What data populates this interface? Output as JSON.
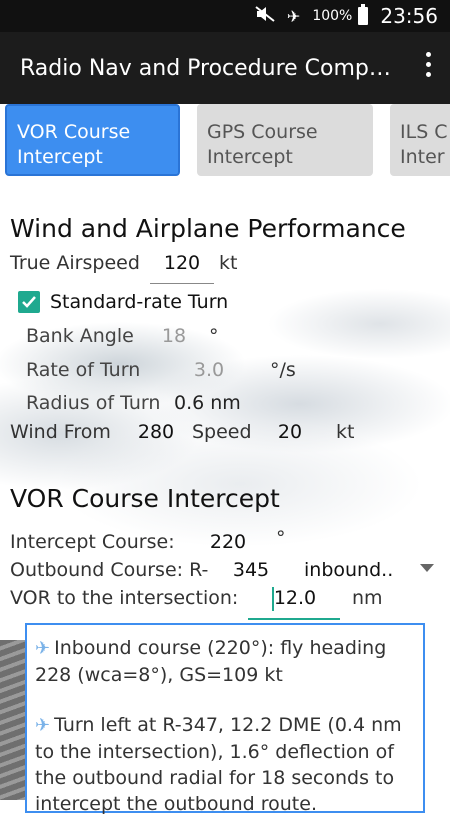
{
  "status_bar": {
    "battery_pct": "100%",
    "time": "23:56",
    "icons": [
      "mute-icon",
      "airplane-mode-icon",
      "battery-icon"
    ]
  },
  "app_bar": {
    "title": "Radio Nav and Procedure Comp…"
  },
  "tabs": [
    {
      "label_line1": "VOR Course",
      "label_line2": "Intercept",
      "active": true
    },
    {
      "label_line1": "GPS Course",
      "label_line2": "Intercept",
      "active": false
    },
    {
      "label_line1": "ILS C",
      "label_line2": "Inter",
      "active": false
    }
  ],
  "wind_section": {
    "heading": "Wind and Airplane Performance",
    "true_airspeed_label": "True Airspeed",
    "true_airspeed_value": "120",
    "true_airspeed_unit": "kt",
    "standard_rate_label": "Standard-rate Turn",
    "standard_rate_checked": true,
    "bank_angle_label": "Bank Angle",
    "bank_angle_value": "18",
    "bank_angle_unit": "°",
    "rate_of_turn_label": "Rate of Turn",
    "rate_of_turn_value": "3.0",
    "rate_of_turn_unit": "°/s",
    "radius_label": "Radius of Turn",
    "radius_value": "0.6 nm",
    "wind_from_label": "Wind From",
    "wind_from_value": "280",
    "speed_label": "Speed",
    "speed_value": "20",
    "speed_unit": "kt"
  },
  "vor_section": {
    "heading": "VOR Course Intercept",
    "intercept_label": "Intercept Course:",
    "intercept_value": "220",
    "intercept_unit": "°",
    "outbound_label": "Outbound Course: R-",
    "outbound_value": "345",
    "direction_value": "inbound..",
    "distance_label": "VOR to the intersection:",
    "distance_value": "12.0",
    "distance_unit": "nm"
  },
  "result": {
    "line1": "Inbound course (220°): fly heading 228 (wca=8°), GS=109 kt",
    "line2": "Turn left at R-347, 12.2 DME (0.4 nm to the intersection), 1.6° deflection of the outbound radial for 18 seconds to intercept the outbound route."
  },
  "colors": {
    "accent": "#3d8ef0",
    "checkbox": "#1fa98f",
    "appbar": "#1c1c1c"
  }
}
